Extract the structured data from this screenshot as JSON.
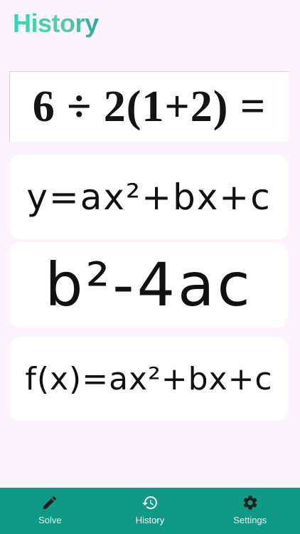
{
  "header": {
    "title": "History"
  },
  "history": [
    {
      "expression": "6 ÷ 2(1+2) ="
    },
    {
      "expression": "y=ax²+bx+c"
    },
    {
      "expression": "b²-4ac"
    },
    {
      "expression": "f(x)=ax²+bx+c"
    }
  ],
  "nav": {
    "items": [
      {
        "label": "Solve",
        "icon": "pencil-icon"
      },
      {
        "label": "History",
        "icon": "history-icon",
        "active": true
      },
      {
        "label": "Settings",
        "icon": "gear-icon"
      }
    ]
  },
  "colors": {
    "accent": "#0f9987",
    "background": "#fcf3fc",
    "title": "#3fd0b0"
  }
}
